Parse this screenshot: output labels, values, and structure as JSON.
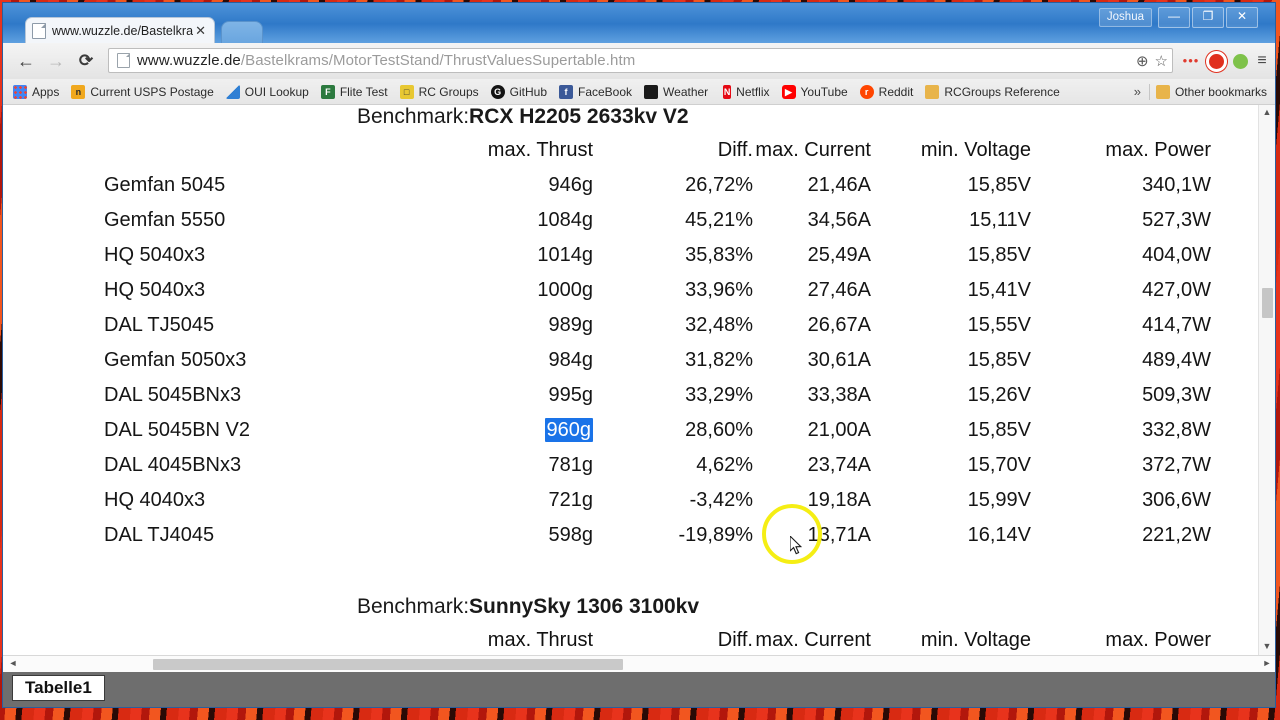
{
  "window": {
    "user_label": "Joshua",
    "minimize": "—",
    "maximize": "❐",
    "close": "✕"
  },
  "tab": {
    "title": "www.wuzzle.de/Bastelkra",
    "close": "✕"
  },
  "toolbar": {
    "back": "←",
    "forward": "→",
    "reload": "⟳",
    "url_domain": "www.wuzzle.de",
    "url_path": "/Bastelkrams/MotorTestStand/ThrustValuesSupertable.htm",
    "zoom_icon": "⊕",
    "bookmark_star": "☆",
    "ext_dots": "•••",
    "menu": "≡"
  },
  "bookmarks": {
    "items": [
      {
        "label": "Apps",
        "icon": "grid-icon",
        "color": "#3b78c8"
      },
      {
        "label": "Current USPS Postage",
        "icon": "n-icon",
        "color": "#f0a81e"
      },
      {
        "label": "OUI Lookup",
        "icon": "triangle-icon",
        "color": "#2f7fd4"
      },
      {
        "label": "Flite Test",
        "icon": "ft-icon",
        "color": "#2c7a3f"
      },
      {
        "label": "RC Groups",
        "icon": "robot-icon",
        "color": "#e8c832"
      },
      {
        "label": "GitHub",
        "icon": "github-icon",
        "color": "#141414"
      },
      {
        "label": "FaceBook",
        "icon": "facebook-icon",
        "color": "#3b5998"
      },
      {
        "label": "Weather",
        "icon": "weather-icon",
        "color": "#1d6fbf"
      },
      {
        "label": "Netflix",
        "icon": "netflix-icon",
        "color": "#e50914"
      },
      {
        "label": "YouTube",
        "icon": "youtube-icon",
        "color": "#ff0000"
      },
      {
        "label": "Reddit",
        "icon": "reddit-icon",
        "color": "#ff4500"
      },
      {
        "label": "RCGroups Reference",
        "icon": "folder-icon",
        "color": "#e8b44a"
      }
    ],
    "overflow": "»",
    "other_bookmarks": {
      "label": "Other bookmarks",
      "icon": "folder-icon"
    }
  },
  "page": {
    "benchmark_prefix": "Benchmark:",
    "columns": [
      "max. Thrust",
      "Diff.",
      "max. Current",
      "min. Voltage",
      "max. Power"
    ],
    "benchmarks": [
      {
        "name": "RCX H2205 2633kv V2",
        "rows": [
          {
            "prop": "Gemfan 5045",
            "thrust": "946g",
            "diff": "26,72%",
            "current": "21,46A",
            "voltage": "15,85V",
            "power": "340,1W"
          },
          {
            "prop": "Gemfan 5550",
            "thrust": "1084g",
            "diff": "45,21%",
            "current": "34,56A",
            "voltage": "15,11V",
            "power": "527,3W"
          },
          {
            "prop": "HQ 5040x3",
            "thrust": "1014g",
            "diff": "35,83%",
            "current": "25,49A",
            "voltage": "15,85V",
            "power": "404,0W"
          },
          {
            "prop": "HQ 5040x3",
            "thrust": "1000g",
            "diff": "33,96%",
            "current": "27,46A",
            "voltage": "15,41V",
            "power": "427,0W"
          },
          {
            "prop": "DAL TJ5045",
            "thrust": "989g",
            "diff": "32,48%",
            "current": "26,67A",
            "voltage": "15,55V",
            "power": "414,7W"
          },
          {
            "prop": "Gemfan 5050x3",
            "thrust": "984g",
            "diff": "31,82%",
            "current": "30,61A",
            "voltage": "15,85V",
            "power": "489,4W"
          },
          {
            "prop": "DAL 5045BNx3",
            "thrust": "995g",
            "diff": "33,29%",
            "current": "33,38A",
            "voltage": "15,26V",
            "power": "509,3W"
          },
          {
            "prop": "DAL 5045BN V2",
            "thrust": "960g",
            "diff": "28,60%",
            "current": "21,00A",
            "voltage": "15,85V",
            "power": "332,8W",
            "selected": true
          },
          {
            "prop": "DAL 4045BNx3",
            "thrust": "781g",
            "diff": "4,62%",
            "current": "23,74A",
            "voltage": "15,70V",
            "power": "372,7W"
          },
          {
            "prop": "HQ 4040x3",
            "thrust": "721g",
            "diff": "-3,42%",
            "current": "19,18A",
            "voltage": "15,99V",
            "power": "306,6W"
          },
          {
            "prop": "DAL TJ4045",
            "thrust": "598g",
            "diff": "-19,89%",
            "current": "13,71A",
            "voltage": "16,14V",
            "power": "221,2W"
          }
        ]
      },
      {
        "name": "SunnySky 1306 3100kv",
        "rows": []
      }
    ],
    "selection_color": "#1a73e8",
    "highlight_ring_color": "#f5ee14"
  },
  "sheet": {
    "tab_label": "Tabelle1"
  },
  "scrollbars": {
    "up": "▲",
    "down": "▼",
    "left": "◄",
    "right": "►"
  }
}
